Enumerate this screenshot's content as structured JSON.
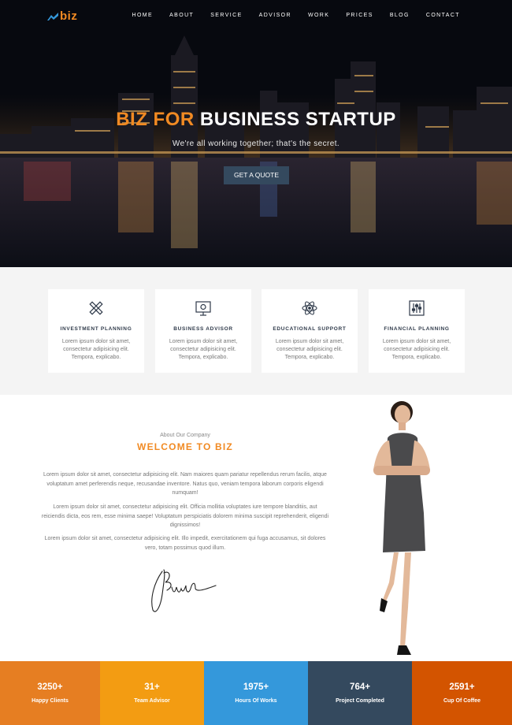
{
  "nav": {
    "logo": "biz",
    "items": [
      "HOME",
      "ABOUT",
      "SERVICE",
      "ADVISOR",
      "WORK",
      "PRICES",
      "BLOG",
      "CONTACT"
    ]
  },
  "hero": {
    "title_accent": "BIZ FOR",
    "title_rest": "BUSINESS STARTUP",
    "subtitle": "We're all working together; that's the secret.",
    "cta": "GET A QUOTE"
  },
  "services": [
    {
      "icon": "pencil-ruler-icon",
      "title": "INVESTMENT PLANNING",
      "text": "Lorem ipsum dolor sit amet, consectetur adipisicing elit. Tempora, explicabo."
    },
    {
      "icon": "presentation-board-icon",
      "title": "BUSINESS ADVISOR",
      "text": "Lorem ipsum dolor sit amet, consectetur adipisicing elit. Tempora, explicabo."
    },
    {
      "icon": "atom-icon",
      "title": "EDUCATIONAL SUPPORT",
      "text": "Lorem ipsum dolor sit amet, consectetur adipisicing elit. Tempora, explicabo."
    },
    {
      "icon": "sliders-icon",
      "title": "FINANCIAL PLANNING",
      "text": "Lorem ipsum dolor sit amet, consectetur adipisicing elit. Tempora, explicabo."
    }
  ],
  "about": {
    "small": "About Our Company",
    "title": "WELCOME TO BIZ",
    "paragraphs": [
      "Lorem ipsum dolor sit amet, consectetur adipisicing elit. Nam maiores quam pariatur repellendus rerum facilis, atque voluptatum amet perferendis neque, recusandae inventore. Natus quo, veniam tempora laborum corporis eligendi numquam!",
      "Lorem ipsum dolor sit amet, consectetur adipisicing elit. Officia mollitia voluptates iure tempore blanditiis, aut reiciendis dicta, eos rem, esse minima saepe! Voluptatum perspiciatis dolorem minima suscipit reprehenderit, eligendi dignissimos!",
      "Lorem ipsum dolor sit amet, consectetur adipisicing elit. Illo impedit, exercitationem qui fuga accusamus, sit dolores vero, totam possimus quod illum."
    ]
  },
  "stats": [
    {
      "value": "3250+",
      "label": "Happy Clients",
      "color": "#e67e22"
    },
    {
      "value": "31+",
      "label": "Team Advisor",
      "color": "#f39c12"
    },
    {
      "value": "1975+",
      "label": "Hours Of Works",
      "color": "#3498db"
    },
    {
      "value": "764+",
      "label": "Project Completed",
      "color": "#34495e"
    },
    {
      "value": "2591+",
      "label": "Cup Of Coffee",
      "color": "#d35400"
    }
  ],
  "colors": {
    "accent": "#f18a23",
    "button": "#34495e"
  }
}
